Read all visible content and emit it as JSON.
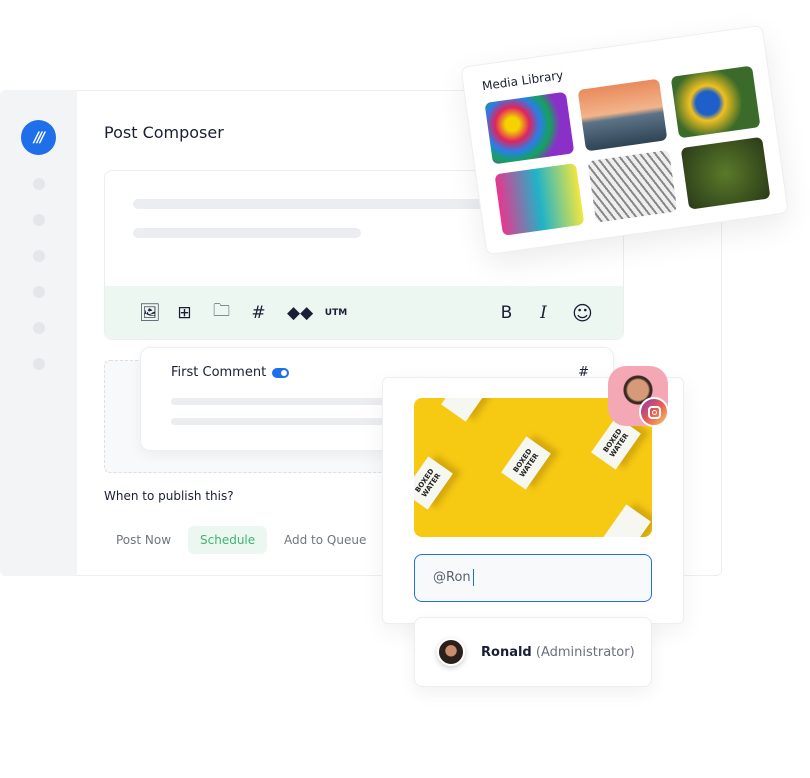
{
  "composer": {
    "title": "Post Composer",
    "toolbar": {
      "icons": [
        "image-add-icon",
        "video-add-icon",
        "folder-icon",
        "hashtag-icon",
        "link-shortener-icon",
        "utm-icon",
        "bold-icon",
        "italic-icon",
        "emoji-icon"
      ],
      "hashtag": "#",
      "utm": "UTM",
      "bold": "B",
      "italic": "I",
      "emoji": "☺"
    }
  },
  "first_comment": {
    "label": "First Comment",
    "enabled": true,
    "hashtag": "#"
  },
  "publish": {
    "question": "When to publish this?",
    "options": [
      "Post Now",
      "Schedule",
      "Add to Queue"
    ],
    "selected": "Schedule"
  },
  "preview": {
    "network": "instagram",
    "image_text": "BOXED WATER",
    "input_value": "@Ron"
  },
  "mention": {
    "name": "Ronald",
    "role": "(Administrator)"
  },
  "media_library": {
    "title": "Media Library"
  },
  "colors": {
    "accent": "#1f6fea",
    "toolbar_bg": "#edf7f1",
    "schedule_text": "#3fb46d"
  }
}
